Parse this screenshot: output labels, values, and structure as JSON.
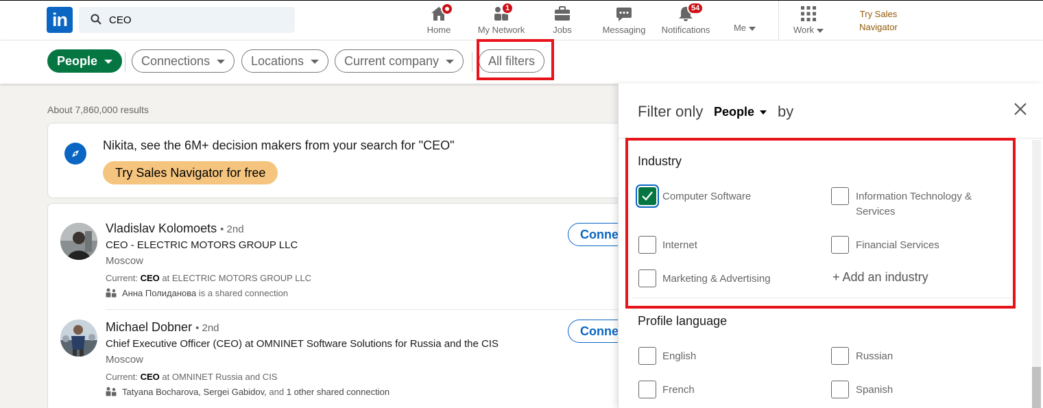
{
  "nav": {
    "logo": "in",
    "search_value": "CEO",
    "items": [
      {
        "label": "Home"
      },
      {
        "label": "My Network",
        "badge": "1"
      },
      {
        "label": "Jobs"
      },
      {
        "label": "Messaging"
      },
      {
        "label": "Notifications",
        "badge": "54"
      },
      {
        "label": "Me"
      },
      {
        "label": "Work"
      }
    ],
    "try_sales_line1": "Try Sales",
    "try_sales_line2": "Navigator"
  },
  "filters": {
    "people": "People",
    "connections": "Connections",
    "locations": "Locations",
    "current_company": "Current company",
    "all_filters": "All filters"
  },
  "results": {
    "count": "About 7,860,000 results",
    "promo_text": "Nikita, see the 6M+ decision makers from your search for \"CEO\"",
    "promo_button": "Try Sales Navigator for free",
    "people": [
      {
        "name": "Vladislav Kolomoets",
        "degree": "• 2nd",
        "title": "CEO - ELECTRIC MOTORS GROUP LLC",
        "location": "Moscow",
        "current_prefix": "Current:",
        "current_bold": "CEO",
        "current_rest": "at ELECTRIC MOTORS GROUP LLC",
        "shared_name": "Анна Полиданова",
        "shared_rest": "is a shared connection",
        "connect": "Connect"
      },
      {
        "name": "Michael Dobner",
        "degree": "• 2nd",
        "title": "Chief Executive Officer (CEO) at OMNINET Software Solutions for Russia and the CIS",
        "location": "Moscow",
        "current_prefix": "Current:",
        "current_bold": "CEO",
        "current_rest": "at OMNINET Russia and CIS",
        "shared_name": "Tatyana Bocharova, Sergei Gabidov,",
        "shared_mid": "and",
        "shared_name2": "1 other shared connection",
        "connect": "Connect"
      }
    ]
  },
  "panel": {
    "filter_only": "Filter only",
    "type_select": "People",
    "by": "by",
    "industry_title": "Industry",
    "industry_options": [
      {
        "label": "Computer Software",
        "checked": true
      },
      {
        "label": "Information Technology &",
        "label2": "Services",
        "checked": false
      },
      {
        "label": "Internet",
        "checked": false
      },
      {
        "label": "Financial Services",
        "checked": false
      },
      {
        "label": "Marketing & Advertising",
        "checked": false
      }
    ],
    "add_industry": "+ Add an industry",
    "language_title": "Profile language",
    "language_options": [
      {
        "label": "English",
        "checked": false
      },
      {
        "label": "Russian",
        "checked": false
      },
      {
        "label": "French",
        "checked": false
      },
      {
        "label": "Spanish",
        "checked": false
      }
    ]
  },
  "colors": {
    "brand_blue": "#0a66c2",
    "active_green": "#057642",
    "highlight_red": "#e8141b",
    "badge_red": "#cc1016",
    "premium_gold": "#f5c57f"
  }
}
